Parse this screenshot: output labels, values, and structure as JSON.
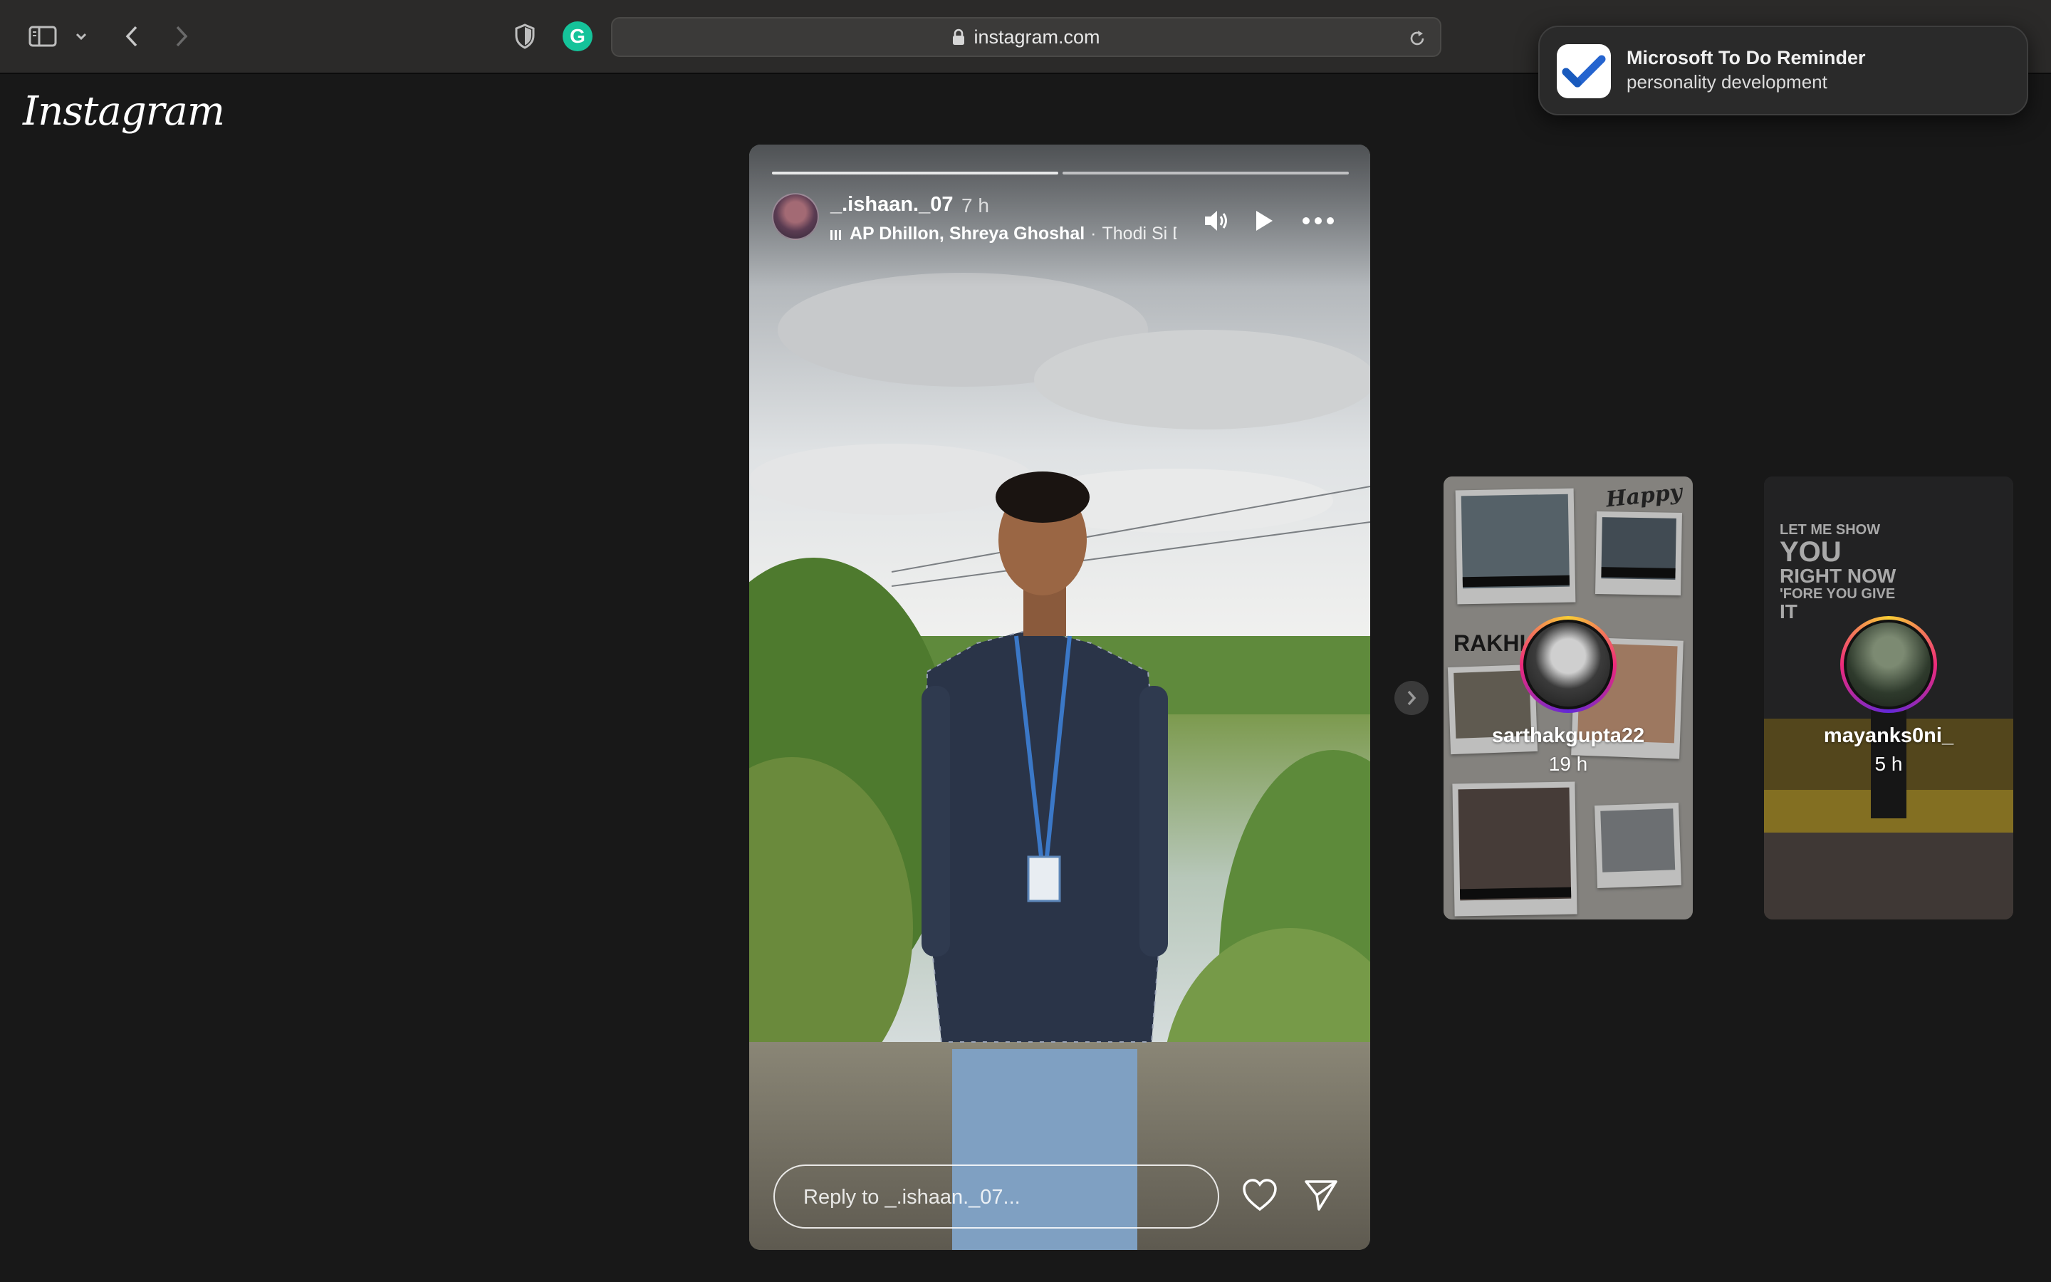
{
  "browser": {
    "url": "instagram.com",
    "icons": {
      "sidebar": "sidebar-icon",
      "back": "chevron-left-icon",
      "forward": "chevron-right-icon",
      "privacy": "shield-icon",
      "extension": "grammarly-icon",
      "lock": "lock-icon",
      "reload": "reload-icon"
    },
    "grammarly_letter": "G"
  },
  "notification": {
    "title": "Microsoft To Do Reminder",
    "body": "personality development",
    "icon": "checkmark-icon"
  },
  "app": {
    "logo": "Instagram"
  },
  "story": {
    "username": "_.ishaan._07",
    "time": "7 h",
    "music": {
      "artist": "AP Dhillon, Shreya Ghoshal",
      "separator": "·",
      "song": "Thodi Si D"
    },
    "progress": [
      1,
      0
    ],
    "reply_placeholder": "Reply to _.ishaan._07...",
    "controls": [
      "volume-icon",
      "play-icon",
      "more-icon",
      "heart-icon",
      "send-icon"
    ]
  },
  "previews": [
    {
      "username": "sarthakgupta22",
      "time": "19 h",
      "art_text": [
        "Happy",
        "RAKHI"
      ]
    },
    {
      "username": "mayanks0ni_",
      "time": "5 h",
      "art_text": [
        "LET ME SHOW",
        "YOU",
        "RIGHT NOW",
        "'FORE YOU GIVE",
        "IT"
      ]
    }
  ],
  "colors": {
    "page_bg": "#181818",
    "toolbar_bg": "#2b2a29",
    "story_ring_start": "#f9ce34",
    "story_ring_end": "#6228d7",
    "grammarly": "#15c39a",
    "todo_blue": "#2564cf"
  }
}
